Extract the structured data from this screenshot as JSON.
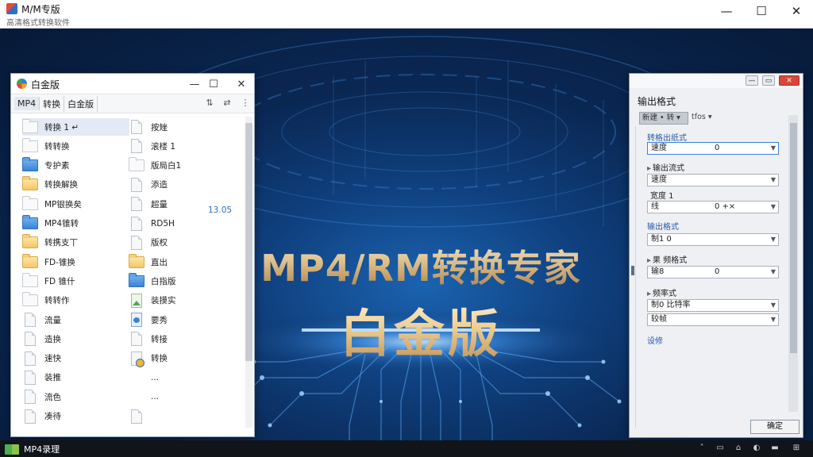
{
  "window": {
    "title": "M/M专版",
    "subtitle": "高清格式转换软件",
    "minimize": "—",
    "maximize": "☐",
    "close": "✕"
  },
  "banner": {
    "headline": "MP4/RM转换专家",
    "edition": "白金版"
  },
  "explorer": {
    "title": "白金版",
    "minimize": "—",
    "maximize": "☐",
    "close": "✕",
    "tabs": [
      "MP4",
      "转换",
      "白金版"
    ],
    "tools": [
      "⇅",
      "⇄",
      "⋮"
    ],
    "left_items": [
      {
        "icon": "folder-white",
        "label": "转换 1 ↵",
        "selected": true
      },
      {
        "icon": "folder-white",
        "label": "转转换"
      },
      {
        "icon": "folder-blue",
        "label": "专护素"
      },
      {
        "icon": "folder",
        "label": "转换解换"
      },
      {
        "icon": "folder-white",
        "label": "MP银换矣"
      },
      {
        "icon": "folder-blue",
        "label": "MP4锥转"
      },
      {
        "icon": "folder",
        "label": "转携支丅"
      },
      {
        "icon": "folder",
        "label": "FD-锥换"
      },
      {
        "icon": "folder-white",
        "label": "FD 锥什"
      },
      {
        "icon": "folder-white",
        "label": "转转作"
      },
      {
        "icon": "doc",
        "label": "流量"
      },
      {
        "icon": "doc",
        "label": "造换"
      },
      {
        "icon": "doc",
        "label": "速快"
      },
      {
        "icon": "doc",
        "label": "装推"
      },
      {
        "icon": "doc",
        "label": "流色"
      },
      {
        "icon": "doc",
        "label": "凑待"
      }
    ],
    "right_items": [
      {
        "icon": "doc",
        "label": "按矬"
      },
      {
        "icon": "doc",
        "label": "滚楼 1"
      },
      {
        "icon": "folder-white",
        "label": "版局白1"
      },
      {
        "icon": "doc",
        "label": "添造"
      },
      {
        "icon": "doc",
        "label": "超量"
      },
      {
        "icon": "doc",
        "label": "RD5H"
      },
      {
        "icon": "doc",
        "label": "版权"
      },
      {
        "icon": "folder",
        "label": "直出"
      },
      {
        "icon": "folder-blue",
        "label": "白指版"
      },
      {
        "icon": "doc-pic",
        "label": "装摸实"
      },
      {
        "icon": "doc-blue",
        "label": "要秀"
      },
      {
        "icon": "doc",
        "label": "转接"
      },
      {
        "icon": "doc-gear",
        "label": "转换"
      },
      {
        "icon": "none",
        "label": "..."
      },
      {
        "icon": "none",
        "label": "..."
      },
      {
        "icon": "doc",
        "label": ""
      }
    ],
    "time_value": "13.05"
  },
  "panel": {
    "header": "输出格式",
    "chip": "新建 • 转 ▾",
    "chip_extra": "tfos ▾",
    "label_1": "转格出纸式",
    "select_1": {
      "text": "速度",
      "value": "0"
    },
    "label_2": "输出流式",
    "select_2": {
      "text": "速度",
      "value": ""
    },
    "minirow_1": "宽度 1",
    "select_3": {
      "text": "线",
      "value": "0 +×"
    },
    "label_3": "输出格式",
    "select_4": {
      "text": "制1 0",
      "value": ""
    },
    "label_4": "果 频格式",
    "select_5": {
      "text": "输8",
      "value": "0"
    },
    "label_5": "频率式",
    "select_6": {
      "text": "制0 比特率",
      "value": ""
    },
    "select_7": {
      "text": "较帧",
      "value": ""
    },
    "link": "设修",
    "ok": "确定"
  },
  "taskbar": {
    "app_label": "MP4录理",
    "tray": [
      "˄",
      "▭",
      "⌂",
      "◐",
      "▬",
      "⊞"
    ]
  },
  "colors": {
    "background": "#0a2753",
    "headline_gold": "#e9c78e",
    "accent_blue": "#2f6fbb"
  }
}
